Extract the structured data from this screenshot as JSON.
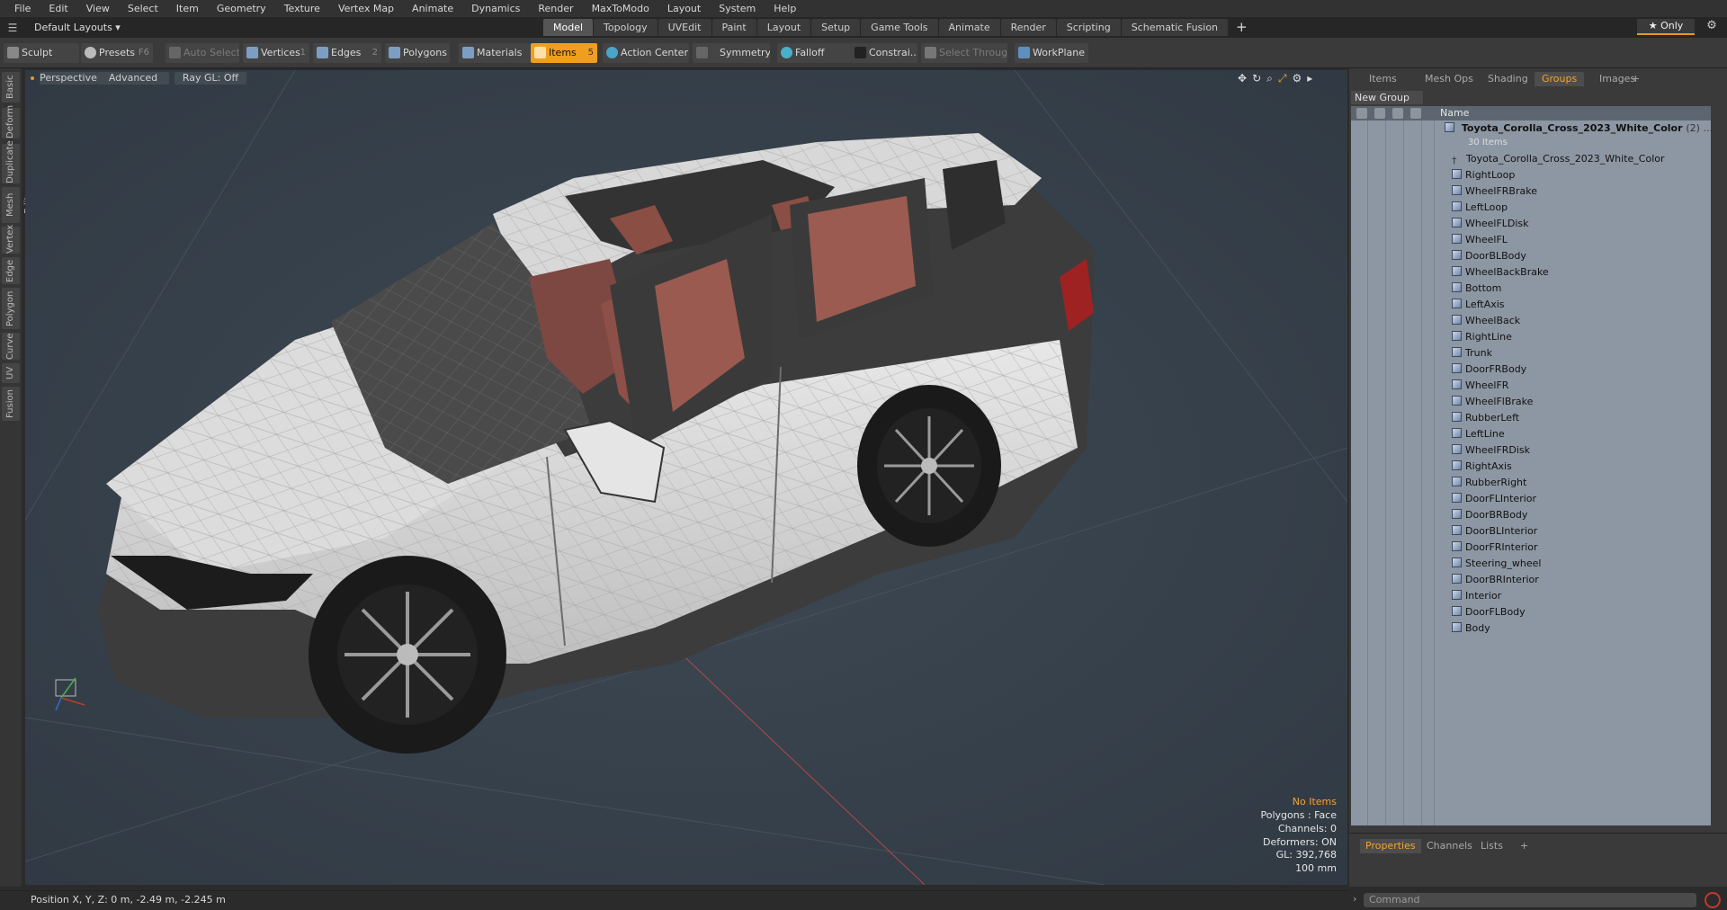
{
  "menu": [
    "File",
    "Edit",
    "View",
    "Select",
    "Item",
    "Geometry",
    "Texture",
    "Vertex Map",
    "Animate",
    "Dynamics",
    "Render",
    "MaxToModo",
    "Layout",
    "System",
    "Help"
  ],
  "layout_select": "Default Layouts ▾",
  "tabs": [
    "Model",
    "Topology",
    "UVEdit",
    "Paint",
    "Layout",
    "Setup",
    "Game Tools",
    "Animate",
    "Render",
    "Scripting",
    "Schematic Fusion"
  ],
  "active_tab": "Model",
  "only_label": "★  Only",
  "toolbar": {
    "sculpt": "Sculpt",
    "presets": "Presets",
    "presets_key": "F6",
    "auto_select": "Auto Select",
    "vertices": "Vertices",
    "vertices_key": "1",
    "edges": "Edges",
    "edges_key": "2",
    "polygons": "Polygons",
    "materials": "Materials",
    "items": "Items",
    "items_key": "5",
    "action_center": "Action Center",
    "symmetry": "Symmetry",
    "falloff": "Falloff",
    "constrain": "Constrai...",
    "select_through": "Select Through",
    "workplane": "WorkPlane"
  },
  "vtabs": [
    "Basic",
    "Deform",
    "Duplicate",
    "Mesh Edit",
    "Vertex",
    "Edge",
    "Polygon",
    "Curve",
    "UV",
    "Fusion"
  ],
  "viewport": {
    "view": "Perspective",
    "shading": "Advanced",
    "raygl": "Ray GL: Off",
    "stats": {
      "selection": "No Items",
      "polygons": "Polygons : Face",
      "channels": "Channels: 0",
      "deformers": "Deformers: ON",
      "gl": "GL: 392,768",
      "grid": "100 mm"
    }
  },
  "right_panel": {
    "tabs": [
      "Items",
      "Mesh Ops",
      "Shading",
      "Groups",
      "Images"
    ],
    "active_tab": "Groups",
    "new_group": "New Group",
    "col_name": "Name",
    "root": {
      "name": "Toyota_Corolla_Cross_2023_White_Color",
      "count_suffix": "(2) ...",
      "sub": "30 Items"
    },
    "items": [
      "Toyota_Corolla_Cross_2023_White_Color",
      "RightLoop",
      "WheelFRBrake",
      "LeftLoop",
      "WheelFLDisk",
      "WheelFL",
      "DoorBLBody",
      "WheelBackBrake",
      "Bottom",
      "LeftAxis",
      "WheelBack",
      "RightLine",
      "Trunk",
      "DoorFRBody",
      "WheelFR",
      "WheelFlBrake",
      "RubberLeft",
      "LeftLine",
      "WheelFRDisk",
      "RightAxis",
      "RubberRight",
      "DoorFLInterior",
      "DoorBRBody",
      "DoorBLInterior",
      "DoorFRInterior",
      "Steering_wheel",
      "DoorBRInterior",
      "Interior",
      "DoorFLBody",
      "Body"
    ]
  },
  "properties": {
    "tabs": [
      "Properties",
      "Channels",
      "Lists"
    ],
    "active_tab": "Properties"
  },
  "status": "Position X, Y, Z:   0 m, -2.49 m, -2.245 m",
  "command_placeholder": "Command",
  "colors": {
    "accent": "#f19e1f",
    "viewport_bg": "#3a4550",
    "list_bg": "#8d97a3"
  }
}
